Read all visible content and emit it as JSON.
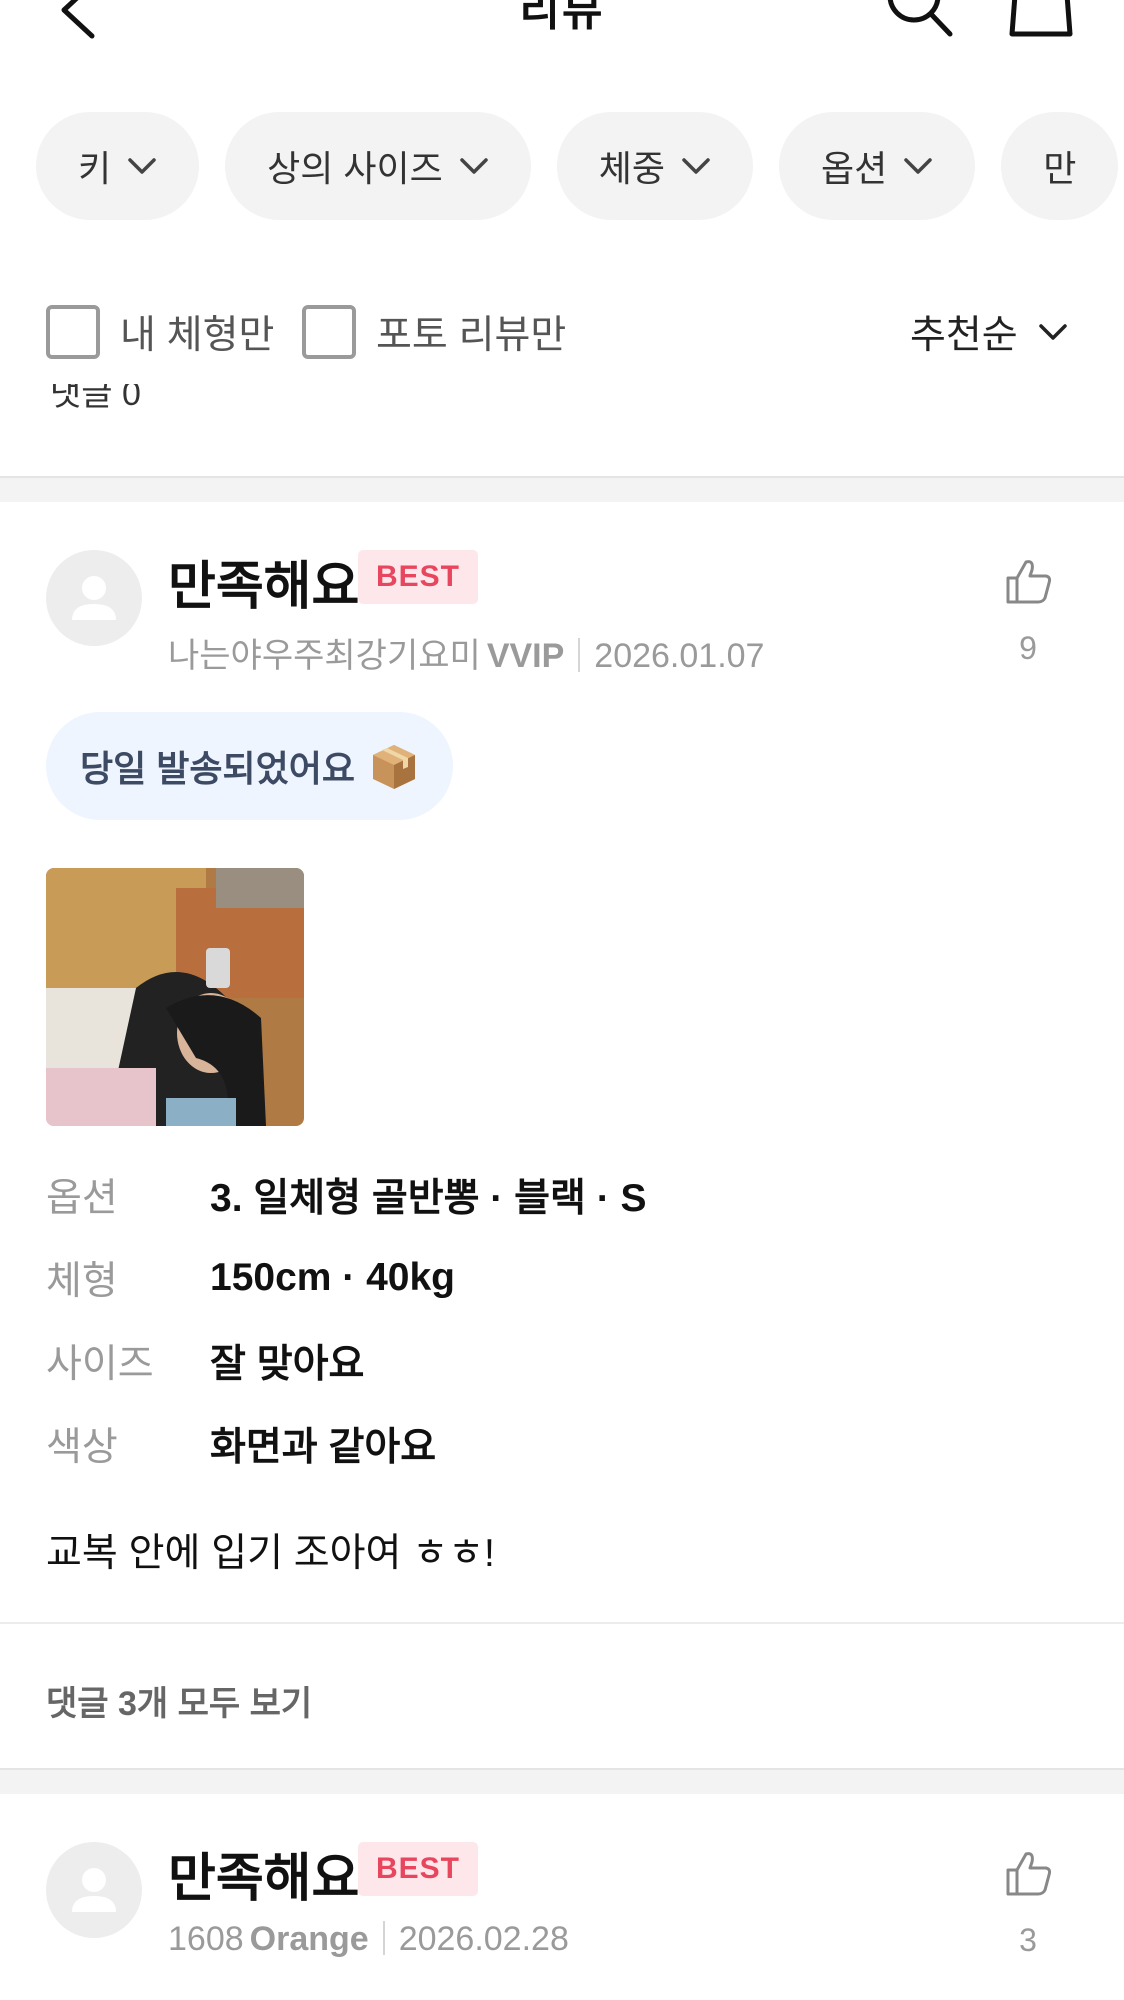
{
  "header": {
    "title": "리뷰",
    "back_icon": "chevron-left-icon",
    "search_icon": "search-icon",
    "bag_icon": "shopping-bag-icon"
  },
  "filter_chips": [
    {
      "label": "키"
    },
    {
      "label": "상의 사이즈"
    },
    {
      "label": "체중"
    },
    {
      "label": "옵션"
    },
    {
      "label": "만"
    }
  ],
  "filters": {
    "my_body_label": "내 체형만",
    "photo_only_label": "포토 리뷰만",
    "sort_label": "추천순"
  },
  "previous_tail": "댓글 0",
  "reviews": [
    {
      "title": "만족해요",
      "badge": "BEST",
      "author": "나는야우주최강기요미",
      "grade": "VVIP",
      "date": "2026.01.07",
      "likes": "9",
      "tag": "당일 발송되었어요",
      "specs": [
        {
          "key": "옵션",
          "value": "3. 일체형 골반뽕 · 블랙 · S"
        },
        {
          "key": "체형",
          "value": "150cm · 40kg"
        },
        {
          "key": "사이즈",
          "value": "잘 맞아요"
        },
        {
          "key": "색상",
          "value": "화면과 같아요"
        }
      ],
      "text": "교복 안에 입기 조아여 ㅎㅎ!",
      "comments": "댓글 3개 모두 보기"
    },
    {
      "title": "만족해요",
      "badge": "BEST",
      "author": "1608",
      "grade": "Orange",
      "date": "2026.02.28",
      "likes": "3"
    }
  ],
  "colors": {
    "badge_bg": "#fde7ea",
    "badge_text": "#e8455e",
    "chip_bg": "#f3f3f3",
    "tag_bg": "#eef5ff",
    "muted_text": "#9a9a9a"
  }
}
